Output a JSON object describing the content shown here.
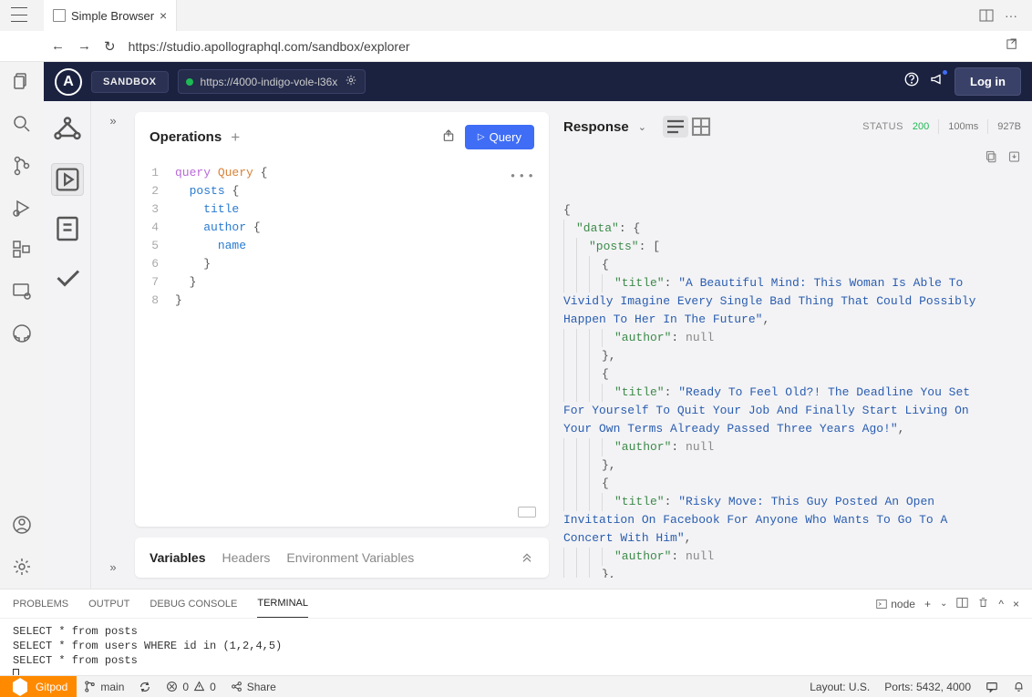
{
  "tab": {
    "title": "Simple Browser"
  },
  "url": "https://studio.apollographql.com/sandbox/explorer",
  "apollo": {
    "sandbox_label": "SANDBOX",
    "endpoint": "https://4000-indigo-vole-l36x",
    "login": "Log in"
  },
  "operations": {
    "title": "Operations",
    "run_label": "Query",
    "lines": [
      {
        "n": 1,
        "html": "<span class='tok-kw'>query</span> <span class='tok-name'>Query</span> <span class='tok-brace'>{</span>"
      },
      {
        "n": 2,
        "html": "  <span class='tok-field'>posts</span> <span class='tok-brace'>{</span>"
      },
      {
        "n": 3,
        "html": "    <span class='tok-field'>title</span>"
      },
      {
        "n": 4,
        "html": "    <span class='tok-field'>author</span> <span class='tok-brace'>{</span>"
      },
      {
        "n": 5,
        "html": "      <span class='tok-field'>name</span>"
      },
      {
        "n": 6,
        "html": "    <span class='tok-brace'>}</span>"
      },
      {
        "n": 7,
        "html": "  <span class='tok-brace'>}</span>"
      },
      {
        "n": 8,
        "html": "<span class='tok-brace'>}</span>"
      }
    ]
  },
  "vars": {
    "tabs": [
      "Variables",
      "Headers",
      "Environment Variables"
    ]
  },
  "response": {
    "title": "Response",
    "status_label": "STATUS",
    "status_code": "200",
    "time": "100ms",
    "size": "927B",
    "posts": [
      {
        "title": "A Beautiful Mind: This Woman Is Able To Vividly Imagine Every Single Bad Thing That Could Possibly Happen To Her In The Future",
        "author": null
      },
      {
        "title": "Ready To Feel Old?! The Deadline You Set For Yourself To Quit Your Job And Finally Start Living On Your Own Terms Already Passed Three Years Ago!",
        "author": null
      },
      {
        "title": "Risky Move: This Guy Posted An Open Invitation On Facebook For Anyone Who Wants To Go To A Concert With Him",
        "author": null
      }
    ]
  },
  "terminal": {
    "tabs": [
      "PROBLEMS",
      "OUTPUT",
      "DEBUG CONSOLE",
      "TERMINAL"
    ],
    "active_tab": 3,
    "shell_label": "node",
    "lines": [
      "SELECT * from posts",
      "SELECT * from users WHERE id in (1,2,4,5)",
      "SELECT * from posts"
    ]
  },
  "statusbar": {
    "gitpod": "Gitpod",
    "branch": "main",
    "errors": "0",
    "warnings": "0",
    "share": "Share",
    "layout": "Layout: U.S.",
    "ports": "Ports: 5432, 4000"
  }
}
